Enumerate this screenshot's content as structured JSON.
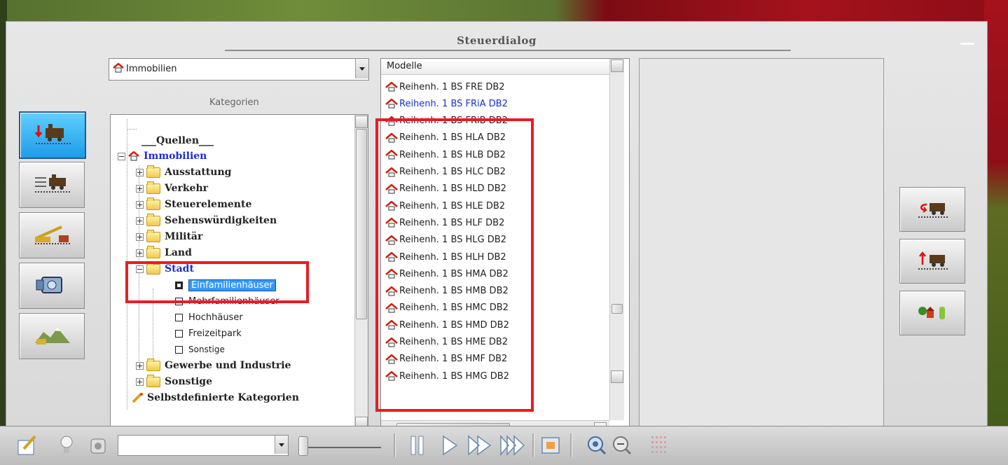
{
  "window": {
    "title": "Steuerdialog"
  },
  "category_select": {
    "value": "Immobilien"
  },
  "categories_label": "Kategorien",
  "tree": {
    "items": [
      {
        "label": "___Quellen___",
        "style": "bold"
      },
      {
        "label": "Immobilien",
        "style": "bold-blue"
      },
      {
        "label": "Ausstattung",
        "style": "bold"
      },
      {
        "label": "Verkehr",
        "style": "bold"
      },
      {
        "label": "Steuerelemente",
        "style": "bold"
      },
      {
        "label": "Sehenswürdigkeiten",
        "style": "bold"
      },
      {
        "label": "Militär",
        "style": "bold"
      },
      {
        "label": "Land",
        "style": "bold"
      },
      {
        "label": "Stadt",
        "style": "bold-blue"
      },
      {
        "label": "Einfamilienhäuser",
        "style": "selected"
      },
      {
        "label": "Mehrfamilienhäuser",
        "style": "plain"
      },
      {
        "label": "Hochhäuser",
        "style": "plain"
      },
      {
        "label": "Freizeitpark",
        "style": "plain"
      },
      {
        "label": "Sonstige",
        "style": "plain"
      },
      {
        "label": "Gewerbe und Industrie",
        "style": "bold"
      },
      {
        "label": "Sonstige",
        "style": "bold"
      },
      {
        "label": "Selbstdefinierte Kategorien",
        "style": "bold"
      }
    ]
  },
  "models": {
    "header": "Modelle",
    "items": [
      "Reihenh. 1 BS FRE DB2",
      "Reihenh. 1 BS FRiA DB2",
      "Reihenh. 1 BS FRiB DB2",
      "Reihenh. 1 BS HLA DB2",
      "Reihenh. 1 BS HLB DB2",
      "Reihenh. 1 BS HLC DB2",
      "Reihenh. 1 BS HLD DB2",
      "Reihenh. 1 BS HLE DB2",
      "Reihenh. 1 BS HLF DB2",
      "Reihenh. 1 BS HLG DB2",
      "Reihenh. 1 BS HLH DB2",
      "Reihenh. 1 BS HMA DB2",
      "Reihenh. 1 BS HMB DB2",
      "Reihenh. 1 BS HMC DB2",
      "Reihenh. 1 BS HMD DB2",
      "Reihenh. 1 BS HME DB2",
      "Reihenh. 1 BS HMF DB2",
      "Reihenh. 1 BS HMG DB2"
    ],
    "highlighted_index": 1
  },
  "colors": {
    "highlight_box": "#e81c24",
    "active_button": "#1f9be8",
    "link_blue": "#1a2fd0"
  },
  "icons": {
    "left_buttons": [
      "insert-train-icon",
      "track-train-icon",
      "crane-icon",
      "camera-icon",
      "landscape-icon"
    ],
    "right_buttons": [
      "return-train-icon",
      "lift-train-icon",
      "trees-house-icon"
    ],
    "toolbar": [
      "edit-icon",
      "bulb-icon",
      "sound-icon",
      "pause-icon",
      "play-icon",
      "fast-forward-icon",
      "fastest-forward-icon",
      "screenshot-icon",
      "zoom-in-icon",
      "zoom-out-icon",
      "grid-icon"
    ]
  }
}
